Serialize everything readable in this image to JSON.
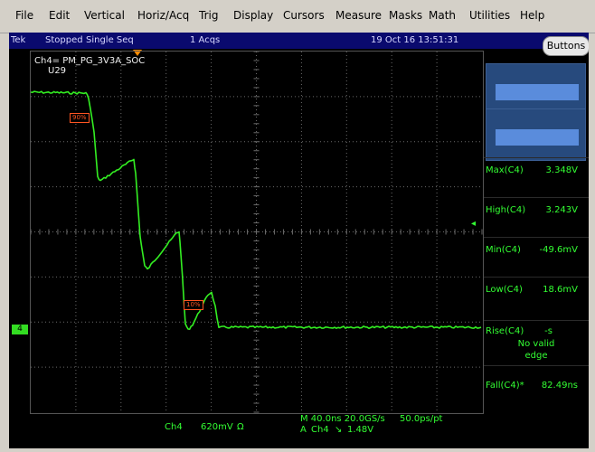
{
  "menu": [
    "File",
    "Edit",
    "Vertical",
    "Horiz/Acq",
    "Trig",
    "Display",
    "Cursors",
    "Measure",
    "Masks",
    "Math",
    "Utilities",
    "Help"
  ],
  "status": {
    "brand": "Tek",
    "state": "Stopped",
    "mode": "Single Seq",
    "acqs": "1 Acqs",
    "datetime": "19 Oct 16 13:51:31",
    "buttons_label": "Buttons"
  },
  "channel": {
    "label": "Ch4= PM_PG_3V3A_SOC",
    "sub": "U29",
    "marker": "4"
  },
  "ref_tags": {
    "high": "90%",
    "low": "10%"
  },
  "measurements": [
    {
      "name": "Max(C4)",
      "value": "3.348V"
    },
    {
      "name": "High(C4)",
      "value": "3.243V"
    },
    {
      "name": "Min(C4)",
      "value": "-49.6mV"
    },
    {
      "name": "Low(C4)",
      "value": "18.6mV"
    },
    {
      "name": "Rise(C4)",
      "value": "-s",
      "note1": "No valid",
      "note2": "edge"
    },
    {
      "name": "Fall(C4)*",
      "value": "82.49ns"
    }
  ],
  "bottom": {
    "ch": "Ch4",
    "scale": "620mV",
    "ohm": "Ω",
    "timebase": "M 40.0ns 20.0GS/s",
    "resolution": "50.0ps/pt",
    "trigger_prefix": "A",
    "trigger_ch": "Ch4",
    "trigger_slope": "↘",
    "trigger_level": "1.48V"
  },
  "colors": {
    "trace": "#33ee22",
    "background": "#000000",
    "status_bar": "#0a0a6e",
    "measurement_text": "#33ff33"
  }
}
